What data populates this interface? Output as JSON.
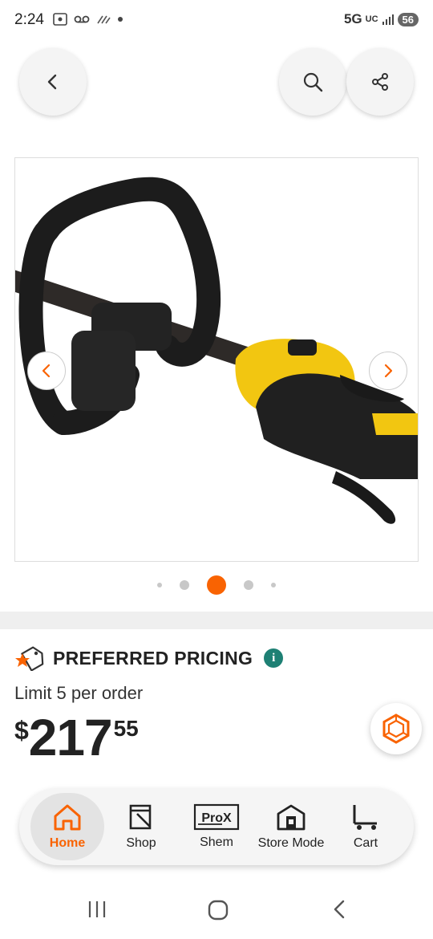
{
  "status_bar": {
    "time": "2:24",
    "network": "5G",
    "network_sub": "UC",
    "battery": "56"
  },
  "header": {
    "back_icon": "chevron-left-icon",
    "search_icon": "search-icon",
    "share_icon": "share-icon"
  },
  "gallery": {
    "image_description_icon": "string-trimmer-product-photo",
    "dot_count": 5,
    "active_dot_index": 2,
    "accent_color": "#f96302"
  },
  "pricing": {
    "badge_label": "PREFERRED PRICING",
    "info_label": "i",
    "limit_text": "Limit 5 per order",
    "price_sign": "$",
    "price_dollars": "217",
    "price_cents": "55"
  },
  "bottom_nav": {
    "items": [
      {
        "label": "Home",
        "icon": "home-icon",
        "active": true
      },
      {
        "label": "Shop",
        "icon": "shop-icon",
        "active": false
      },
      {
        "label": "Shem",
        "icon": "prox-icon",
        "active": false
      },
      {
        "label": "Store Mode",
        "icon": "store-icon",
        "active": false
      },
      {
        "label": "Cart",
        "icon": "cart-icon",
        "active": false
      }
    ],
    "prox_icon_text": "ProX"
  },
  "colors": {
    "brand_orange": "#f96302",
    "info_teal": "#1e8074"
  }
}
